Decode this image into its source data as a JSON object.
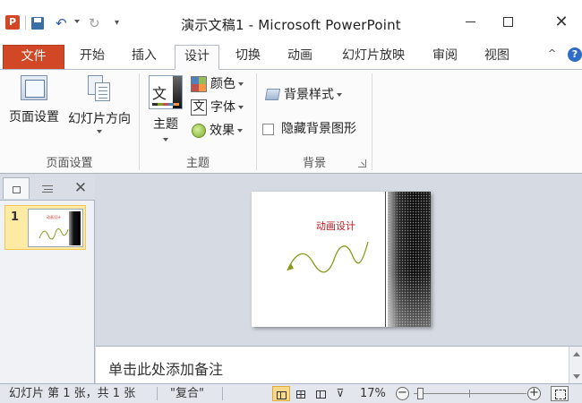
{
  "app": {
    "icon_letter": "P",
    "title": "演示文稿1 - Microsoft PowerPoint"
  },
  "quick_access": {
    "save_icon": "save-icon",
    "undo_glyph": "↶",
    "redo_glyph": "↻",
    "customize_glyph": "▾"
  },
  "window_controls": {
    "close_glyph": "✕"
  },
  "tabs": [
    {
      "label": "文件"
    },
    {
      "label": "开始"
    },
    {
      "label": "插入"
    },
    {
      "label": "设计"
    },
    {
      "label": "切换"
    },
    {
      "label": "动画"
    },
    {
      "label": "幻灯片放映"
    },
    {
      "label": "审阅"
    },
    {
      "label": "视图"
    }
  ],
  "active_tab": "设计",
  "tab_bar": {
    "collapse_glyph": "^",
    "help_glyph": "?"
  },
  "ribbon": {
    "page_setup_group": {
      "page_setup_label": "页面设置",
      "orientation_label": "幻灯片方向",
      "group_label": "页面设置"
    },
    "themes_group": {
      "theme_label": "主题",
      "theme_thumb_glyph": "文",
      "colors_label": "颜色",
      "fonts_label": "字体",
      "fonts_icon_glyph": "文",
      "effects_label": "效果",
      "group_label": "主题"
    },
    "background_group": {
      "background_styles_label": "背景样式",
      "hide_background_label": "隐藏背景图形",
      "hide_background_checked": false,
      "group_label": "背景"
    }
  },
  "slides_pane": {
    "close_glyph": "✕",
    "slides": [
      {
        "number": "1",
        "title": "动画设计"
      }
    ]
  },
  "current_slide": {
    "title": "动画设计"
  },
  "notes": {
    "placeholder": "单击此处添加备注"
  },
  "status_bar": {
    "slide_info": "幻灯片 第 1 张，共 1 张",
    "theme_name": "\"复合\"",
    "zoom_level": "17%",
    "zoom_out_glyph": "−",
    "zoom_in_glyph": "+"
  },
  "colors": {
    "file_tab": "#d24726",
    "slide_title": "#c0161a",
    "slide_curve": "#8a9a1e",
    "selected_slide_bg": "#fdeaa3"
  }
}
